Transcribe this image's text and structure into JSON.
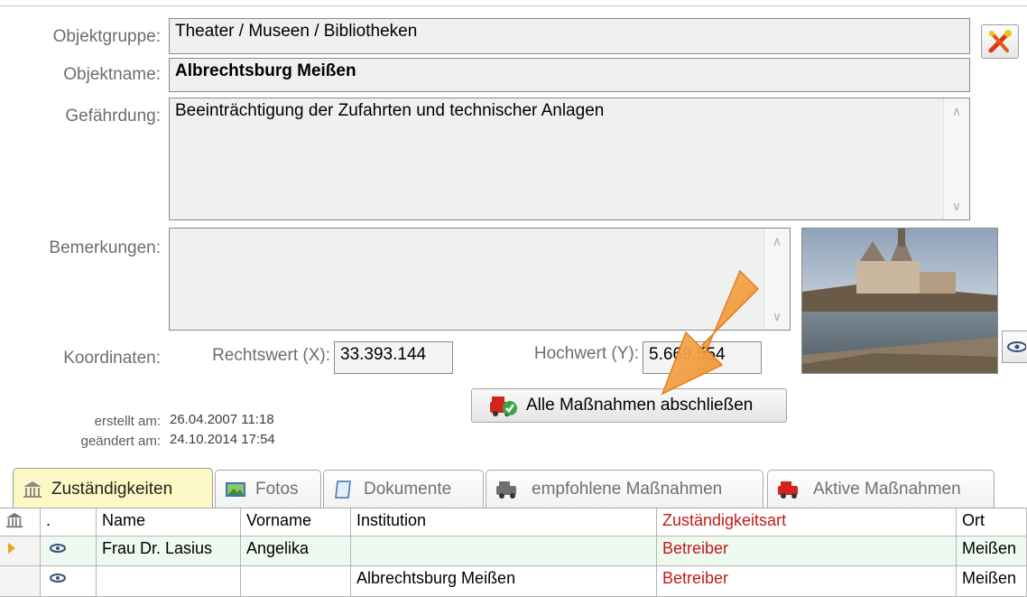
{
  "form": {
    "objektgruppe_label": "Objektgruppe:",
    "objektgruppe_value": "Theater / Museen / Bibliotheken",
    "objektname_label": "Objektname:",
    "objektname_value": "Albrechtsburg Meißen",
    "gefaehrdung_label": "Gefährdung:",
    "gefaehrdung_value": "Beeinträchtigung der Zufahrten und technischer Anlagen",
    "bemerkungen_label": "Bemerkungen:",
    "bemerkungen_value": "",
    "koordinaten_label": "Koordinaten:",
    "rechtswert_label": "Rechtswert (X):",
    "rechtswert_value": "33.393.144",
    "hochwert_label": "Hochwert (Y):",
    "hochwert_value": "5.669.554",
    "erstellt_label": "erstellt am:",
    "erstellt_value": "26.04.2007 11:18",
    "geaendert_label": "geändert am:",
    "geaendert_value": "24.10.2014 17:54",
    "action_button_label": "Alle Maßnahmen abschließen"
  },
  "tabs": [
    {
      "label": "Zuständigkeiten",
      "icon": "building-icon",
      "active": true
    },
    {
      "label": "Fotos",
      "icon": "photo-icon",
      "active": false
    },
    {
      "label": "Dokumente",
      "icon": "document-icon",
      "active": false
    },
    {
      "label": "empfohlene Maßnahmen",
      "icon": "fire-truck-icon",
      "active": false
    },
    {
      "label": "Aktive Maßnahmen",
      "icon": "fire-truck-red-icon",
      "active": false
    }
  ],
  "table": {
    "columns": [
      ".",
      "Name",
      "Vorname",
      "Institution",
      "Zuständigkeitsart",
      "Ort"
    ],
    "rows": [
      {
        "name": "Frau Dr. Lasius",
        "vorname": "Angelika",
        "institution": "",
        "art": "Betreiber",
        "ort": "Meißen"
      },
      {
        "name": "",
        "vorname": "",
        "institution": "Albrechtsburg Meißen",
        "art": "Betreiber",
        "ort": "Meißen"
      }
    ]
  },
  "colors": {
    "accent_red": "#c21a1a",
    "active_tab": "#fdf9c4",
    "arrow_orange": "#f0922e"
  }
}
